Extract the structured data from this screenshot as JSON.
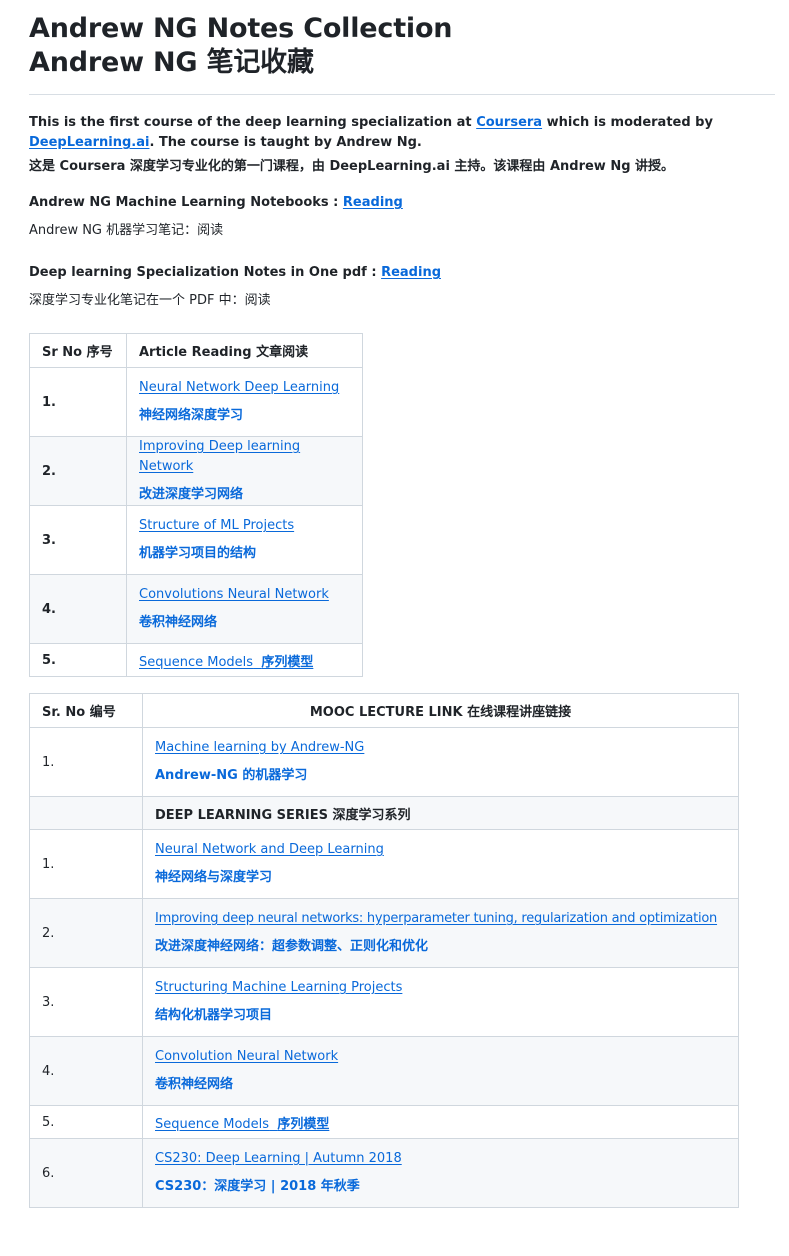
{
  "title": {
    "en": "Andrew NG Notes Collection",
    "zh": "Andrew NG 笔记收藏"
  },
  "intro": {
    "en_prefix": "This is the first course of the deep learning specialization at ",
    "en_link1": "Coursera",
    "en_middle": " which is moderated by ",
    "en_link2": "DeepLearning.ai",
    "en_suffix": ". The course is taught by Andrew Ng.",
    "zh": "这是 Coursera 深度学习专业化的第一门课程，由 DeepLearning.ai 主持。该课程由 Andrew Ng 讲授。"
  },
  "ml_notebooks": {
    "en_label": "Andrew NG Machine Learning Notebooks : ",
    "en_link": "Reading",
    "zh": "Andrew NG 机器学习笔记：阅读"
  },
  "dl_pdf": {
    "en_label": "Deep learning Specialization Notes in One pdf : ",
    "en_link": "Reading",
    "zh": "深度学习专业化笔记在一个 PDF 中：阅读"
  },
  "table1": {
    "headers": [
      "Sr No  序号",
      "Article Reading  文章阅读"
    ],
    "rows": [
      {
        "no": "1.",
        "en": "Neural Network Deep Learning",
        "zh": "神经网络深度学习"
      },
      {
        "no": "2.",
        "en": "Improving Deep learning Network",
        "zh": "改进深度学习网络"
      },
      {
        "no": "3.",
        "en": "Structure of ML Projects",
        "zh": "机器学习项目的结构"
      },
      {
        "no": "4.",
        "en": "Convolutions Neural Network",
        "zh": "卷积神经网络"
      },
      {
        "no": "5.",
        "en": "Sequence Models",
        "zh": "序列模型"
      }
    ]
  },
  "table2": {
    "headers": [
      "Sr. No  编号",
      "MOOC LECTURE LINK  在线课程讲座链接"
    ],
    "first_row": {
      "no": "1.",
      "en": "Machine learning by Andrew-NG",
      "zh": "Andrew-NG 的机器学习"
    },
    "series_heading": "DEEP LEARNING SERIES  深度学习系列",
    "rows": [
      {
        "no": "1.",
        "en": "Neural Network and Deep Learning",
        "zh": "神经网络与深度学习"
      },
      {
        "no": "2.",
        "en": "Improving deep neural networks: hyperparameter tuning, regularization and optimization",
        "zh": "改进深度神经网络：超参数调整、正则化和优化"
      },
      {
        "no": "3.",
        "en": "Structuring Machine Learning Projects",
        "zh": "结构化机器学习项目"
      },
      {
        "no": "4.",
        "en": "Convolution Neural Network",
        "zh": "卷积神经网络"
      },
      {
        "no": "5.",
        "en": "Sequence Models",
        "zh": "序列模型"
      },
      {
        "no": "6.",
        "en": "CS230: Deep Learning | Autumn 2018",
        "zh": "CS230：深度学习 | 2018 年秋季"
      }
    ]
  },
  "colors": {
    "link": "#0969da",
    "text": "#1f2328",
    "border": "#d0d7de",
    "row_alt": "#f6f8fa"
  }
}
